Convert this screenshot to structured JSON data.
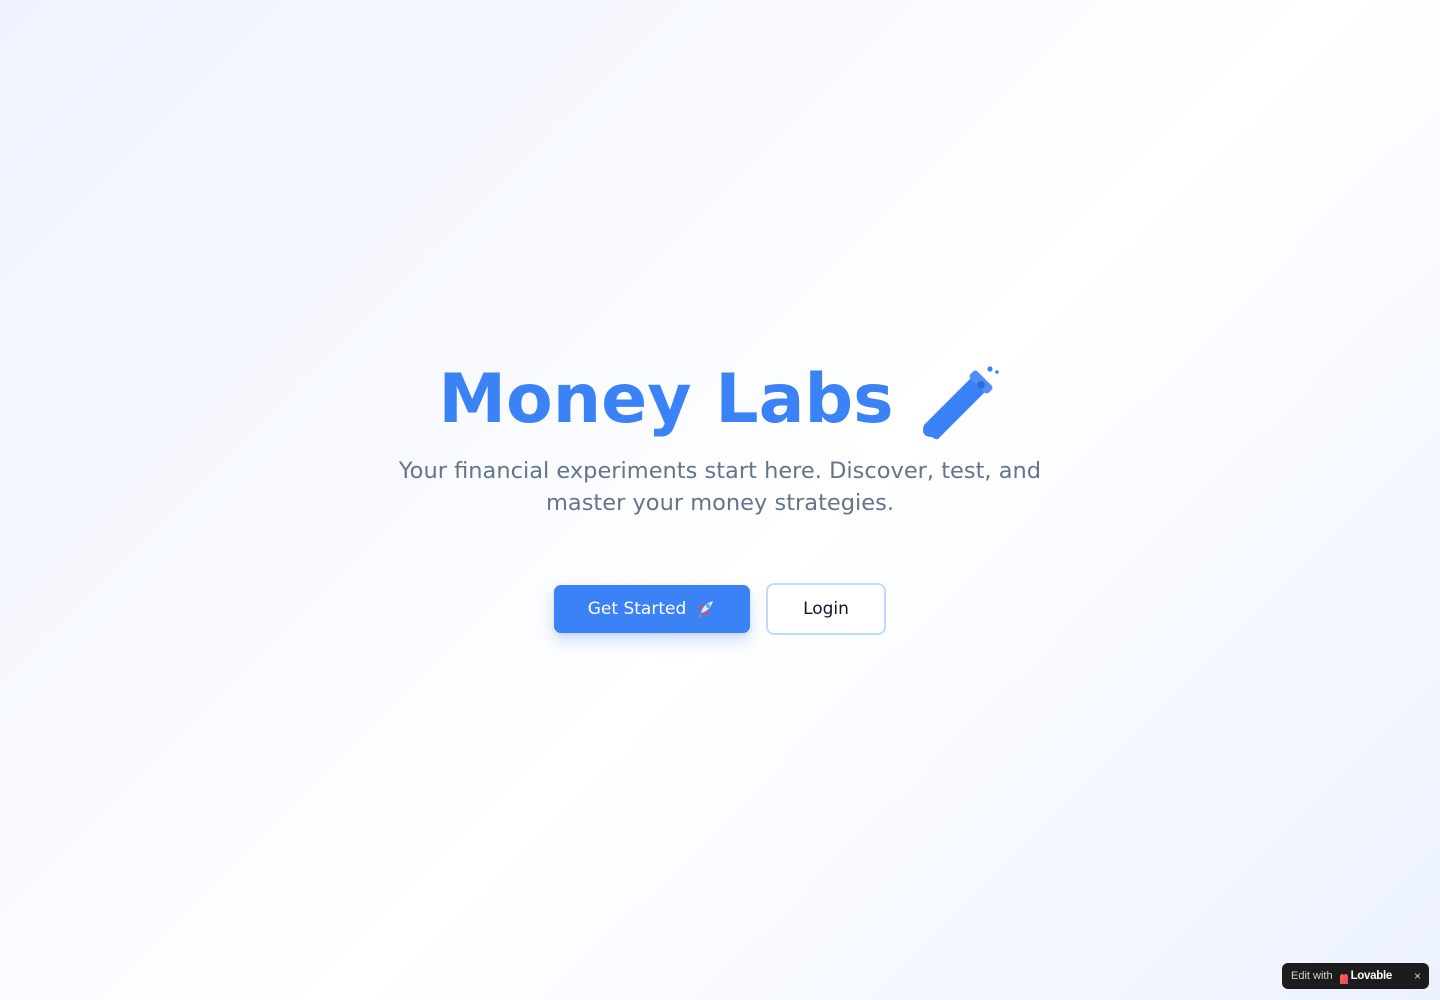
{
  "hero": {
    "title": "Money Labs",
    "title_icon": "test-tube-icon",
    "subtitle": "Your financial experiments start here. Discover, test, and master your money strategies."
  },
  "actions": {
    "primary_label": "Get Started",
    "primary_icon": "rocket-icon",
    "secondary_label": "Login"
  },
  "badge": {
    "prefix": "Edit with",
    "brand": "Lovable",
    "close": "×"
  },
  "colors": {
    "accent": "#3b82f6",
    "muted_text": "#64748b",
    "secondary_border": "#bfdbfe",
    "badge_bg": "#1c1c1c"
  }
}
